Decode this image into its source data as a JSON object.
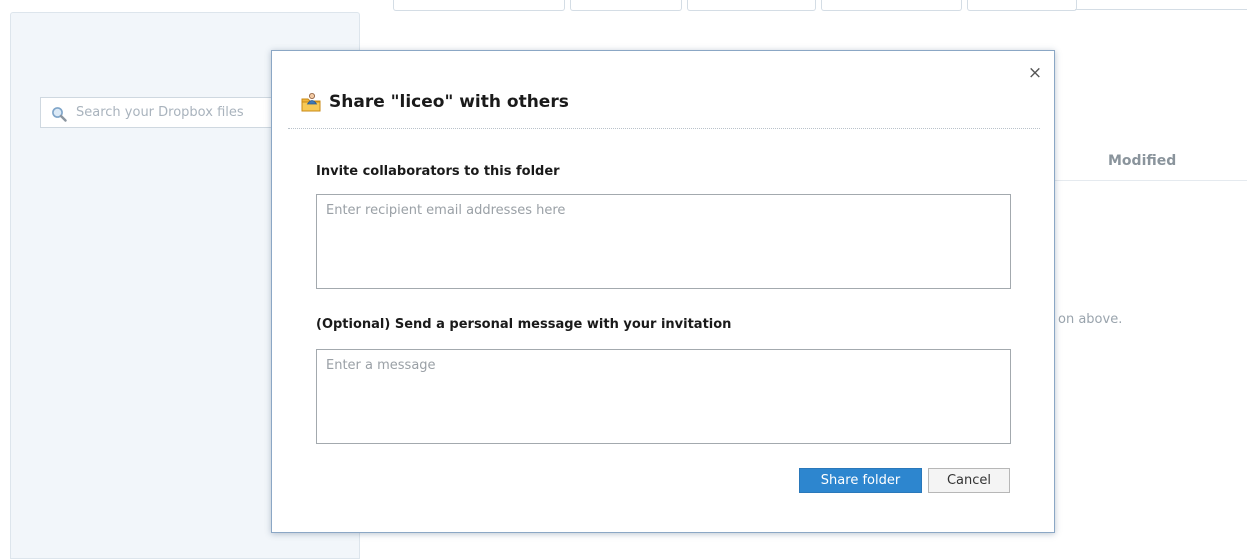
{
  "background": {
    "search": {
      "placeholder": "Search your Dropbox files"
    },
    "file_list": {
      "column_modified": "Modified",
      "empty_hint": "on above."
    }
  },
  "dialog": {
    "title": "Share \"liceo\" with others",
    "close_glyph": "×",
    "invite": {
      "label": "Invite collaborators to this folder",
      "placeholder": "Enter recipient email addresses here",
      "value": ""
    },
    "message": {
      "label": "(Optional) Send a personal message with your invitation",
      "placeholder": "Enter a message",
      "value": ""
    },
    "buttons": {
      "share": "Share folder",
      "cancel": "Cancel"
    },
    "icons": {
      "title_icon": "share-folder-icon",
      "close_icon": "close-icon"
    }
  },
  "colors": {
    "primary_button": "#2d86cf",
    "dialog_border": "#8ba7c5",
    "sidebar_bg": "#f2f6fa"
  }
}
